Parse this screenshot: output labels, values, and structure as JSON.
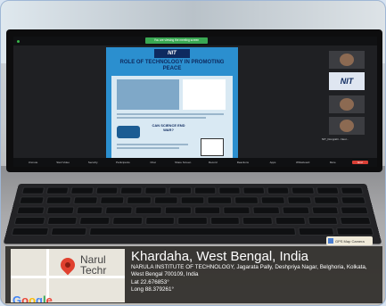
{
  "screen": {
    "banner_text": "You are viewing the meeting screen",
    "slide": {
      "logo_text": "NIT",
      "title": "ROLE OF TECHNOLOGY IN PROMOTING PEACE",
      "question": "CAN SCIENCE END WAR?"
    },
    "gallery": {
      "logo_tile_text": "NIT",
      "name_label": "NIT_Dongrahi - Neur..."
    },
    "controls": [
      "Unmute",
      "Start Video",
      "Security",
      "Participants",
      "Chat",
      "Share Screen",
      "Record",
      "Reactions",
      "Apps",
      "Whiteboard",
      "More",
      "End"
    ]
  },
  "keyboard_sticker": "GPS Map Camera",
  "geotag": {
    "map_label_line1": "Narul",
    "map_label_line2": "Techr",
    "google_logo": [
      "G",
      "o",
      "o",
      "g",
      "l",
      "e"
    ],
    "place": "Khardaha, West Bengal, India",
    "address": "NARULA INSTITUTE OF TECHNOLOGY, Jagarata Pally, Deshpriya Nagar, Belghoria, Kolkata, West Bengal 700109, India",
    "lat": "Lat 22.676853°",
    "long": "Long 88.379261°"
  },
  "colors": {
    "pin": "#e0412f",
    "end_button": "#d93f36",
    "slide_bg": "#2b8fcf",
    "banner": "#3aa853"
  }
}
